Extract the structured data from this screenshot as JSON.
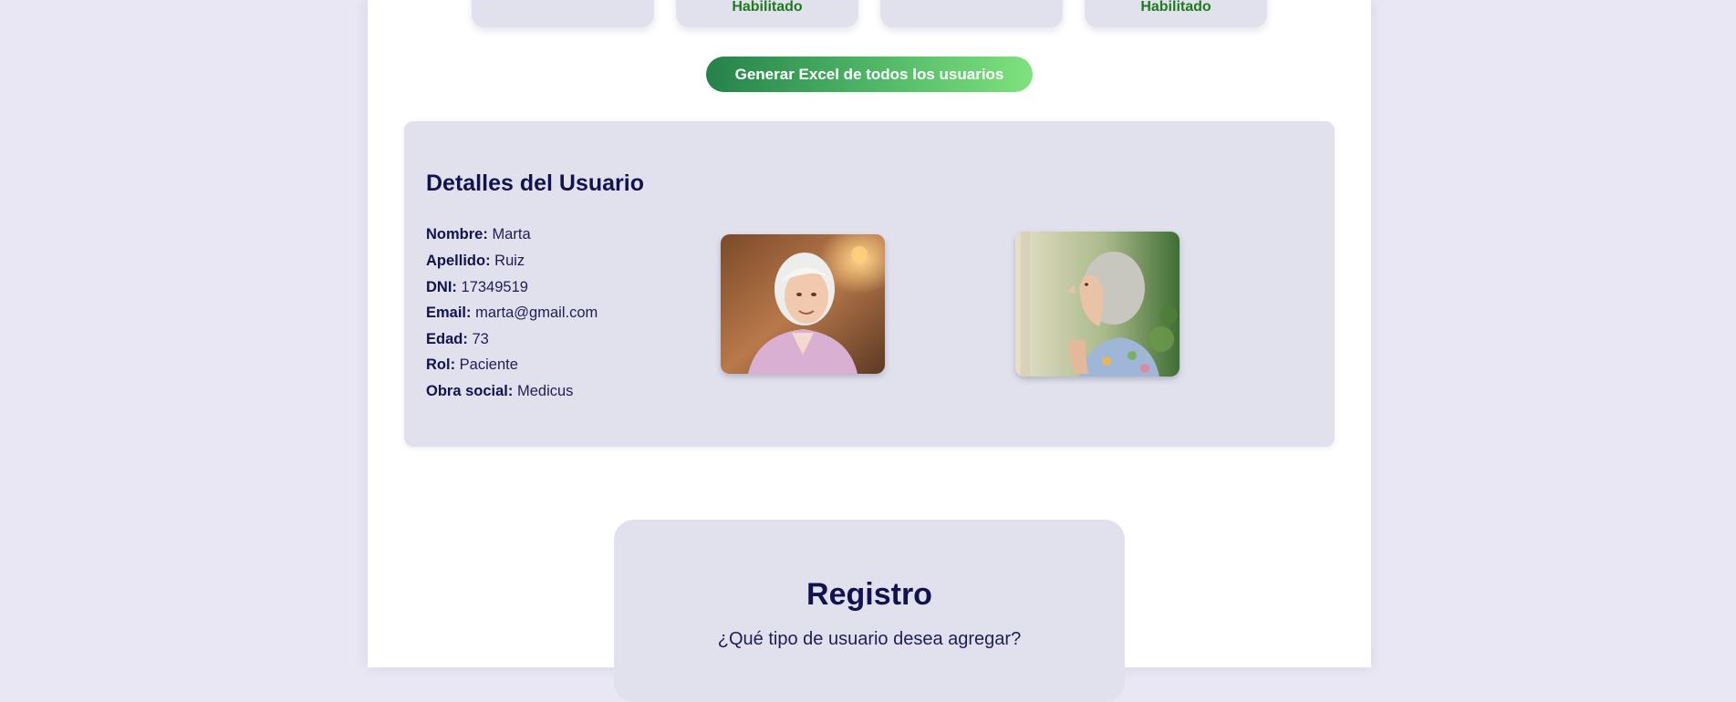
{
  "user_cards": [
    {
      "status": ""
    },
    {
      "status": "Habilitado"
    },
    {
      "status": ""
    },
    {
      "status": "Habilitado"
    }
  ],
  "excel_button_label": "Generar Excel de todos los usuarios",
  "details": {
    "title": "Detalles del Usuario",
    "fields": [
      {
        "label": "Nombre:",
        "value": "Marta"
      },
      {
        "label": "Apellido:",
        "value": "Ruiz"
      },
      {
        "label": "DNI:",
        "value": "17349519"
      },
      {
        "label": "Email:",
        "value": "marta@gmail.com"
      },
      {
        "label": "Edad:",
        "value": "73"
      },
      {
        "label": "Rol:",
        "value": "Paciente"
      },
      {
        "label": "Obra social:",
        "value": "Medicus"
      }
    ]
  },
  "registro": {
    "title": "Registro",
    "subtitle": "¿Qué tipo de usuario desea agregar?"
  },
  "colors": {
    "page_background": "#e9e7f4",
    "panel": "#e1e1ee",
    "navy_text": "#12124e",
    "status_green": "#1c7c1c",
    "button_gradient_start": "#25824a",
    "button_gradient_end": "#7fe27e"
  }
}
